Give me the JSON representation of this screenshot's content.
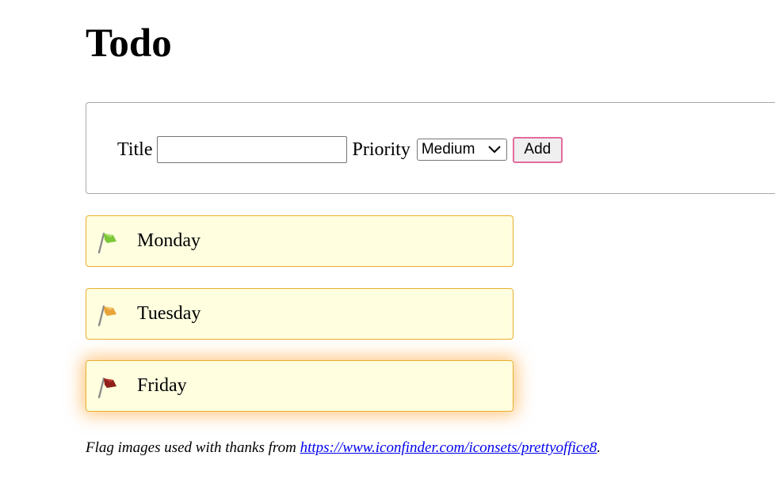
{
  "heading": "Todo",
  "form": {
    "title_label": "Title",
    "title_value": "",
    "priority_label": "Priority",
    "priority_selected": "Medium",
    "add_label": "Add"
  },
  "todos": [
    {
      "label": "Monday",
      "priority": "low",
      "flag_color": "#7ec83a",
      "flag_icon": "green-flag-icon"
    },
    {
      "label": "Tuesday",
      "priority": "medium",
      "flag_color": "#e8a33a",
      "flag_icon": "orange-flag-icon"
    },
    {
      "label": "Friday",
      "priority": "high",
      "flag_color": "#8e1f1a",
      "flag_icon": "red-flag-icon"
    }
  ],
  "credit": {
    "prefix": "Flag images used with thanks from ",
    "link_text": "https://www.iconfinder.com/iconsets/prettyoffice8",
    "suffix": "."
  },
  "colors": {
    "item_background": "#ffffe0",
    "item_border": "#e8b030",
    "button_border": "#e46c9c",
    "link": "#0000ee"
  }
}
